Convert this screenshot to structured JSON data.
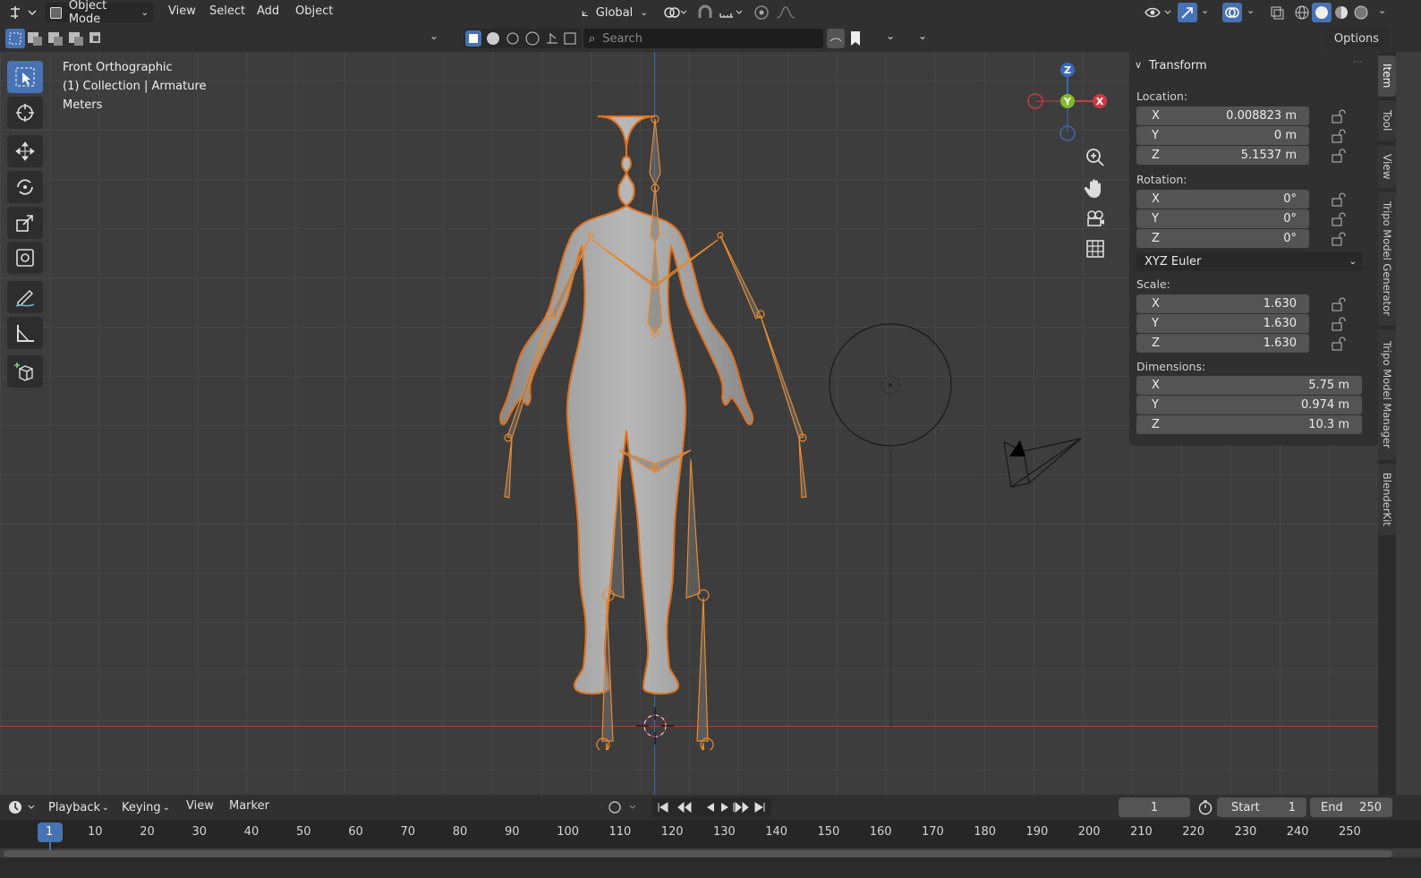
{
  "topbar": {
    "mode": "Object Mode",
    "menus": [
      "View",
      "Select",
      "Add",
      "Object"
    ],
    "transform_orientation": "Global",
    "options_label": "Options"
  },
  "header2": {
    "search_placeholder": "Search"
  },
  "overlay": {
    "view_name": "Front Orthographic",
    "collection": "(1) Collection | Armature",
    "units": "Meters"
  },
  "gizmo": {
    "z": "Z",
    "y": "Y",
    "x": "X"
  },
  "npanel": {
    "title": "Transform",
    "location_label": "Location:",
    "location": [
      {
        "axis": "X",
        "value": "0.008823 m"
      },
      {
        "axis": "Y",
        "value": "0 m"
      },
      {
        "axis": "Z",
        "value": "5.1537 m"
      }
    ],
    "rotation_label": "Rotation:",
    "rotation": [
      {
        "axis": "X",
        "value": "0°"
      },
      {
        "axis": "Y",
        "value": "0°"
      },
      {
        "axis": "Z",
        "value": "0°"
      }
    ],
    "rotation_mode": "XYZ Euler",
    "scale_label": "Scale:",
    "scale": [
      {
        "axis": "X",
        "value": "1.630"
      },
      {
        "axis": "Y",
        "value": "1.630"
      },
      {
        "axis": "Z",
        "value": "1.630"
      }
    ],
    "dimensions_label": "Dimensions:",
    "dimensions": [
      {
        "axis": "X",
        "value": "5.75 m"
      },
      {
        "axis": "Y",
        "value": "0.974 m"
      },
      {
        "axis": "Z",
        "value": "10.3 m"
      }
    ]
  },
  "sidebar_tabs": [
    "Item",
    "Tool",
    "View",
    "Tripo Model Generator",
    "Tripo Model Manager",
    "BlenderKit"
  ],
  "timeline": {
    "menus": [
      "Playback",
      "Keying",
      "View",
      "Marker"
    ],
    "current_frame": "1",
    "start_label": "Start",
    "start_value": "1",
    "end_label": "End",
    "end_value": "250",
    "ticks": [
      "1",
      "10",
      "20",
      "30",
      "40",
      "50",
      "60",
      "70",
      "80",
      "90",
      "100",
      "110",
      "120",
      "130",
      "140",
      "150",
      "160",
      "170",
      "180",
      "190",
      "200",
      "210",
      "220",
      "230",
      "240",
      "250"
    ]
  }
}
